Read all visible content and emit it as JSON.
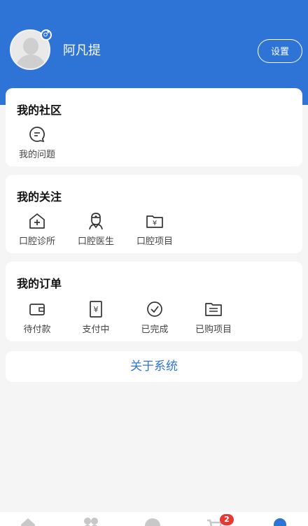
{
  "profile": {
    "username": "阿凡提",
    "gender_symbol": "♂",
    "settings_label": "设置"
  },
  "community": {
    "title": "我的社区",
    "items": [
      {
        "label": "我的问题",
        "icon": "chat-bubble-icon"
      }
    ]
  },
  "follow": {
    "title": "我的关注",
    "items": [
      {
        "label": "口腔诊所",
        "icon": "clinic-icon"
      },
      {
        "label": "口腔医生",
        "icon": "doctor-icon"
      },
      {
        "label": "口腔项目",
        "icon": "project-folder-icon"
      }
    ]
  },
  "orders": {
    "title": "我的订单",
    "items": [
      {
        "label": "待付款",
        "icon": "wallet-icon"
      },
      {
        "label": "支付中",
        "icon": "paying-icon"
      },
      {
        "label": "已完成",
        "icon": "check-circle-icon"
      },
      {
        "label": "已购项目",
        "icon": "list-icon"
      }
    ]
  },
  "about_label": "关于系统",
  "tabbar": {
    "cart_badge": "2"
  },
  "colors": {
    "brand": "#2e74d6",
    "badge": "#e53935"
  }
}
